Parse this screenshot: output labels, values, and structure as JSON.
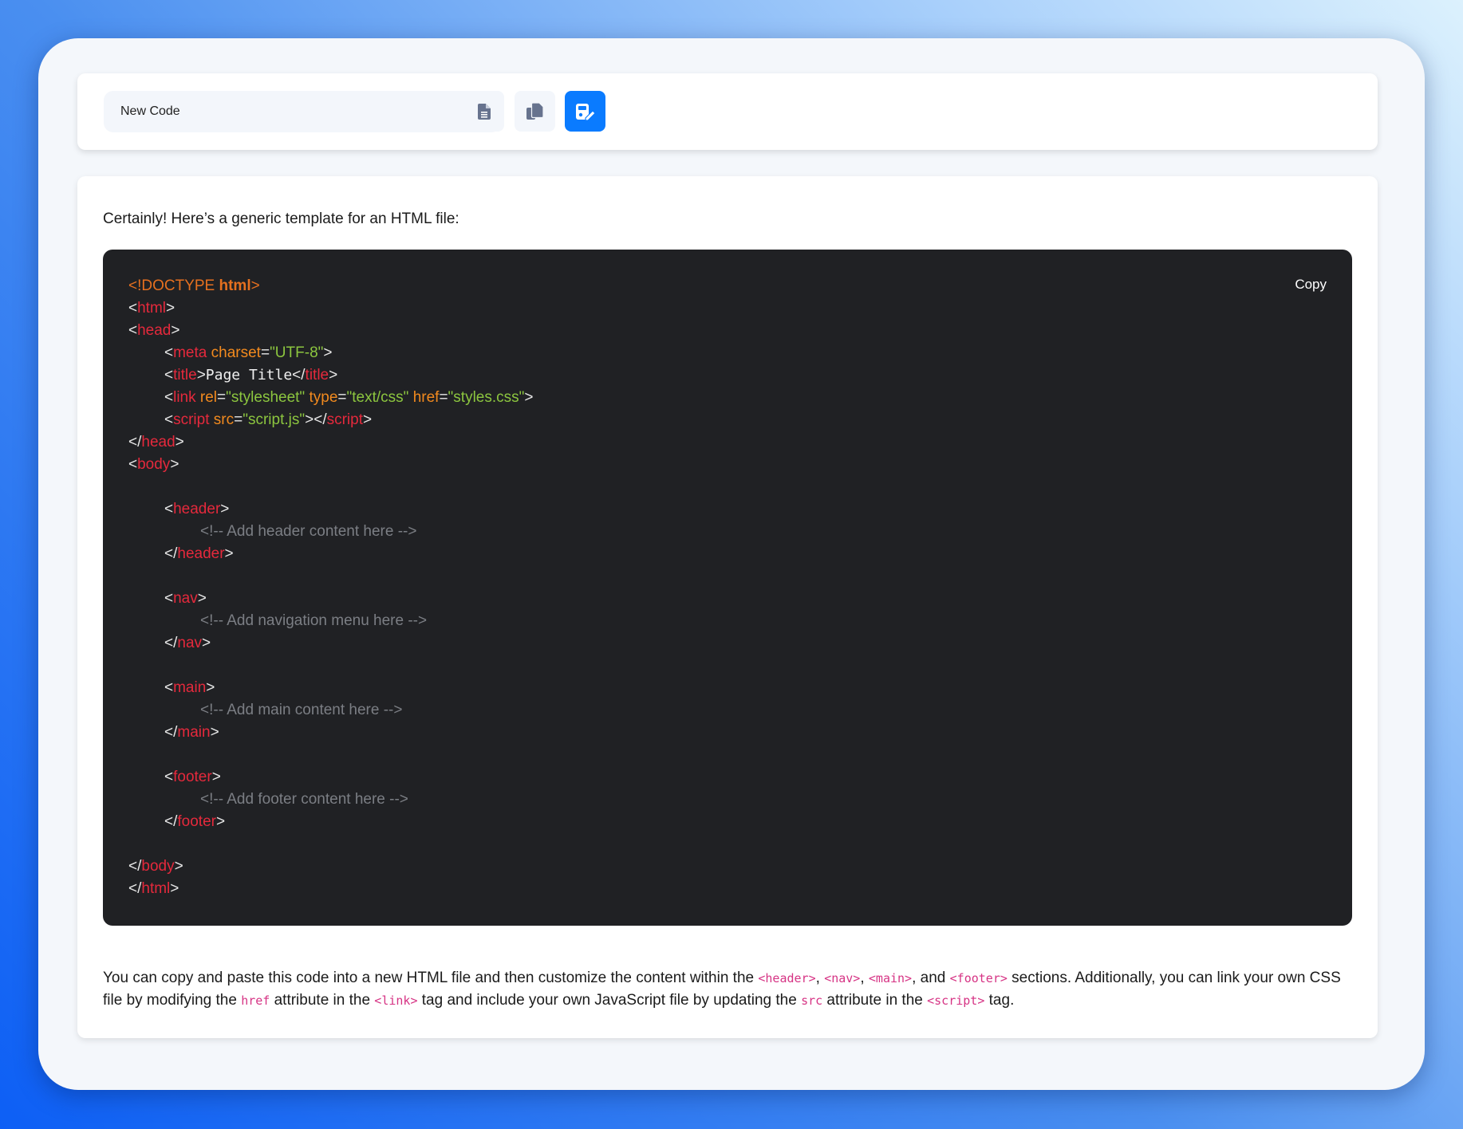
{
  "toolbar": {
    "name_value": "New Code",
    "buttons": [
      {
        "icon": "file-icon",
        "label": "New file"
      },
      {
        "icon": "copy-icon",
        "label": "Duplicate"
      },
      {
        "icon": "save-edit-icon",
        "label": "Save"
      }
    ],
    "accent_color": "#0a7bff"
  },
  "message": {
    "intro": "Certainly! Here’s a generic template for an HTML file:",
    "copy_label": "Copy",
    "code": {
      "doctype_open": "<!DOCTYPE ",
      "doctype_kw": "html",
      "doctype_close": ">",
      "page_title": "Page Title",
      "meta_charset": "\"UTF-8\"",
      "link_rel": "\"stylesheet\"",
      "link_type": "\"text/css\"",
      "link_href": "\"styles.css\"",
      "script_src": "\"script.js\"",
      "comment_header": "<!-- Add header content here -->",
      "comment_nav": "<!-- Add navigation menu here -->",
      "comment_main": "<!-- Add main content here -->",
      "comment_footer": "<!-- Add footer content here -->"
    },
    "outro": {
      "t1": "You can copy and paste this code into a new HTML file and then customize the content within the ",
      "c1": "<header>",
      "t2": ", ",
      "c2": "<nav>",
      "t3": ", ",
      "c3": "<main>",
      "t4": ", and ",
      "c4": "<footer>",
      "t5": " sections. Additionally, you can link your own CSS file by modifying the ",
      "c5": "href",
      "t6": " attribute in the ",
      "c6": "<link>",
      "t7": " tag and include your own JavaScript file by updating the ",
      "c7": "src",
      "t8": " attribute in the ",
      "c8": "<script>",
      "t9": " tag."
    }
  }
}
